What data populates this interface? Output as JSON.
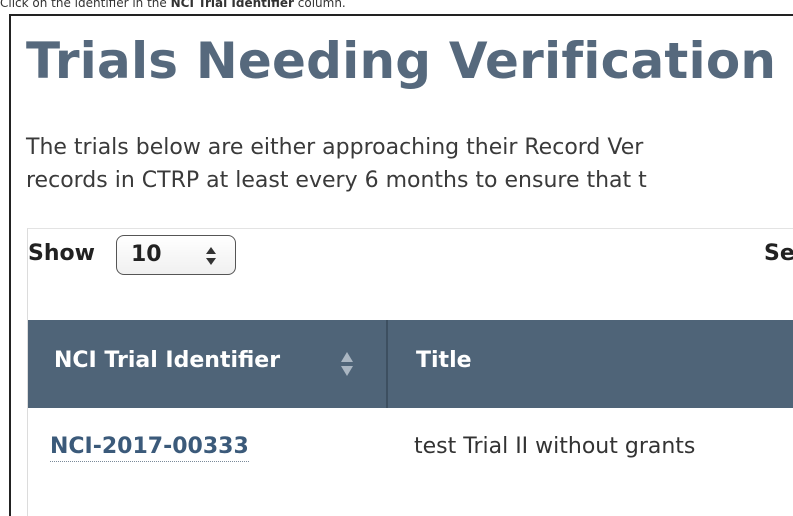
{
  "caption": {
    "prefix": "Click on the identifier in the ",
    "bold": "NCI Trial Identifier",
    "suffix": " column."
  },
  "page": {
    "title": "Trials Needing Verification",
    "intro_line1": "The trials below are either approaching their Record Ver",
    "intro_line2": "records in CTRP at least every 6 months to ensure that t"
  },
  "controls": {
    "show_label": "Show",
    "page_size_value": "10",
    "search_label_partial": "Se"
  },
  "table": {
    "columns": [
      {
        "label": "NCI Trial Identifier",
        "sortable": true
      },
      {
        "label": "Title",
        "sortable": false
      }
    ],
    "rows": [
      {
        "identifier": "NCI-2017-00333",
        "title": "test Trial II without grants"
      }
    ]
  },
  "colors": {
    "header_bg": "#4f6478",
    "title_color": "#56697d",
    "link_color": "#3b5a7a"
  },
  "icons": {
    "select_arrows": "updown-caret-icon",
    "sort": "sort-both-icon"
  }
}
